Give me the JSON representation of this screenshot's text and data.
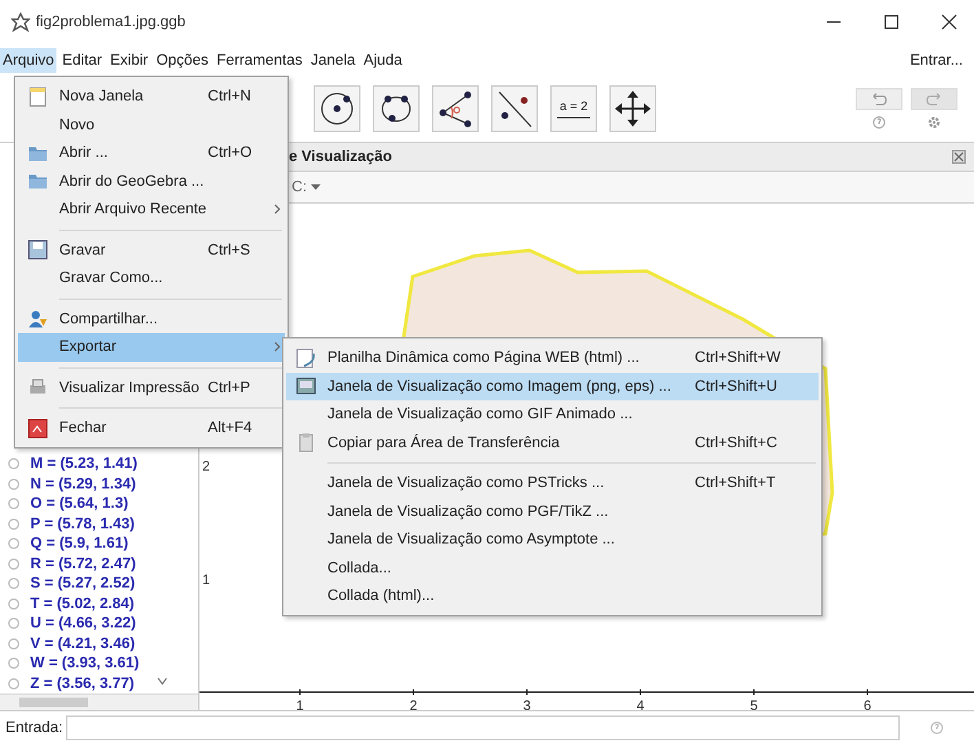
{
  "window": {
    "title": "fig2problema1.jpg.ggb"
  },
  "menu_bar": {
    "items": [
      {
        "label": "Arquivo",
        "selected": true
      },
      {
        "label": "Editar",
        "selected": false
      },
      {
        "label": "Exibir",
        "selected": false
      },
      {
        "label": "Opções",
        "selected": false
      },
      {
        "label": "Ferramentas",
        "selected": false
      },
      {
        "label": "Janela",
        "selected": false
      },
      {
        "label": "Ajuda",
        "selected": false
      }
    ],
    "login": "Entrar..."
  },
  "toolbar": {
    "slider_tool_label": "a = 2"
  },
  "algebra_view": {
    "items": [
      {
        "text": "M = (5.23, 1.41)",
        "visible": false
      },
      {
        "text": "N = (5.29, 1.34)",
        "visible": false
      },
      {
        "text": "O = (5.64, 1.3)",
        "visible": false
      },
      {
        "text": "P = (5.78, 1.43)",
        "visible": false
      },
      {
        "text": "Q = (5.9, 1.61)",
        "visible": false
      },
      {
        "text": "R = (5.72, 2.47)",
        "visible": false
      },
      {
        "text": "S = (5.27, 2.52)",
        "visible": false
      },
      {
        "text": "T = (5.02, 2.84)",
        "visible": false
      },
      {
        "text": "U = (4.66, 3.22)",
        "visible": false
      },
      {
        "text": "V = (4.21, 3.46)",
        "visible": false
      },
      {
        "text": "W = (3.93, 3.61)",
        "visible": false
      },
      {
        "text": "Z = (3.56, 3.77)",
        "visible": false
      }
    ]
  },
  "graphics_view": {
    "title": "e Visualização",
    "style_bar": "C:",
    "x_labels": [
      "1",
      "2",
      "3",
      "4",
      "5",
      "6"
    ],
    "y_labels": [
      "2",
      "1"
    ]
  },
  "input_bar": {
    "label": "Entrada:"
  },
  "file_menu": {
    "items": [
      {
        "kind": "item",
        "label": "Nova Janela",
        "shortcut": "Ctrl+N",
        "submenu": false,
        "selected": false
      },
      {
        "kind": "item",
        "label": "Novo",
        "submenu": false,
        "selected": false
      },
      {
        "kind": "item",
        "label": "Abrir ...",
        "shortcut": "Ctrl+O",
        "submenu": false,
        "selected": false
      },
      {
        "kind": "item",
        "label": "Abrir do GeoGebra ...",
        "submenu": false,
        "selected": false
      },
      {
        "kind": "item",
        "label": "Abrir Arquivo Recente",
        "submenu": true,
        "selected": false
      },
      {
        "kind": "separator"
      },
      {
        "kind": "item",
        "label": "Gravar",
        "shortcut": "Ctrl+S",
        "submenu": false,
        "selected": false
      },
      {
        "kind": "item",
        "label": "Gravar Como...",
        "submenu": false,
        "selected": false
      },
      {
        "kind": "separator"
      },
      {
        "kind": "item",
        "label": "Compartilhar...",
        "submenu": false,
        "selected": false
      },
      {
        "kind": "item",
        "label": "Exportar",
        "submenu": true,
        "selected": true
      },
      {
        "kind": "separator"
      },
      {
        "kind": "item",
        "label": "Visualizar Impressão",
        "shortcut": "Ctrl+P",
        "submenu": false,
        "selected": false
      },
      {
        "kind": "separator"
      },
      {
        "kind": "item",
        "label": "Fechar",
        "shortcut": "Alt+F4",
        "submenu": false,
        "selected": false
      }
    ]
  },
  "export_submenu": {
    "items": [
      {
        "kind": "item",
        "label": "Planilha Dinâmica como Página WEB (html) ...",
        "shortcut": "Ctrl+Shift+W",
        "selected": false
      },
      {
        "kind": "item",
        "label": "Janela de Visualização como Imagem (png, eps) ...",
        "shortcut": "Ctrl+Shift+U",
        "selected": true
      },
      {
        "kind": "item",
        "label": "Janela de Visualização como GIF Animado ...",
        "selected": false
      },
      {
        "kind": "item",
        "label": "Copiar para Área de Transferência",
        "shortcut": "Ctrl+Shift+C",
        "selected": false
      },
      {
        "kind": "separator"
      },
      {
        "kind": "item",
        "label": "Janela de Visualização como PSTricks ...",
        "shortcut": "Ctrl+Shift+T",
        "selected": false
      },
      {
        "kind": "item",
        "label": "Janela de Visualização como PGF/TikZ ...",
        "selected": false
      },
      {
        "kind": "item",
        "label": "Janela de Visualização como Asymptote ...",
        "selected": false
      },
      {
        "kind": "item",
        "label": "Collada...",
        "selected": false
      },
      {
        "kind": "item",
        "label": "Collada (html)...",
        "selected": false
      }
    ]
  }
}
